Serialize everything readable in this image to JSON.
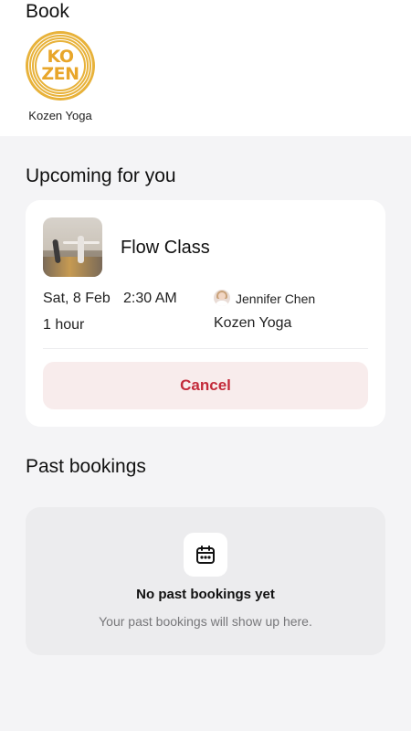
{
  "header": {
    "title": "Book"
  },
  "studio": {
    "logo_line1": "KO",
    "logo_line2": "ZEN",
    "name": "Kozen Yoga",
    "brand_color": "#e8b23a"
  },
  "upcoming": {
    "section_title": "Upcoming for you",
    "booking": {
      "class_name": "Flow Class",
      "thumbnail": "yoga-class-photo",
      "date": "Sat, 8 Feb",
      "time": "2:30 AM",
      "duration": "1 hour",
      "instructor": "Jennifer Chen",
      "location": "Kozen Yoga",
      "cancel_label": "Cancel",
      "cancel_color": "#c32a3a"
    }
  },
  "past": {
    "section_title": "Past bookings",
    "empty_icon": "calendar-icon",
    "empty_title": "No past bookings yet",
    "empty_subtitle": "Your past bookings will show up here."
  }
}
